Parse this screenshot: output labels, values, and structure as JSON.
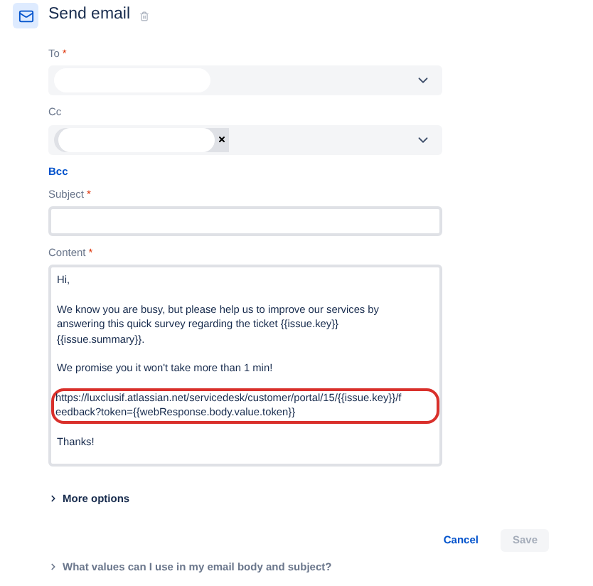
{
  "header": {
    "title": "Send email"
  },
  "fields": [
    {
      "kind": "select",
      "label": "To",
      "required_mark": "*",
      "chips": [
        {
          "removable": false
        }
      ]
    },
    {
      "kind": "select",
      "label": "Cc",
      "chips": [
        {
          "removable": true
        }
      ]
    },
    {
      "kind": "link",
      "label": "Bcc"
    },
    {
      "kind": "text",
      "label": "Subject",
      "required_mark": "*"
    },
    {
      "kind": "textarea",
      "label": "Content",
      "required_mark": "*",
      "paragraphs": [
        {
          "lines": [
            "Hi,"
          ],
          "highlighted": false
        },
        {
          "lines": [
            "We know you are busy, but please help us to improve our services by",
            "answering this quick survey regarding the ticket {{issue.key}}",
            "{{issue.summary}}."
          ],
          "highlighted": false
        },
        {
          "lines": [
            "We promise you it won't take more than 1 min!"
          ],
          "highlighted": false
        },
        {
          "lines": [
            "https://luxclusif.atlassian.net/servicedesk/customer/portal/15/{{issue.key}}/f",
            "eedback?token={{webResponse.body.value.token}}"
          ],
          "highlighted": true
        },
        {
          "lines": [
            "Thanks!"
          ],
          "highlighted": false
        }
      ]
    }
  ],
  "more_options": {
    "label": "More options",
    "expanded": false
  },
  "buttons": [
    {
      "label": "Cancel",
      "disabled": false,
      "kind": "link"
    },
    {
      "label": "Save",
      "disabled": true,
      "kind": "primary"
    }
  ],
  "help": {
    "label": "What values can I use in my email body and subject?",
    "expanded": false
  }
}
